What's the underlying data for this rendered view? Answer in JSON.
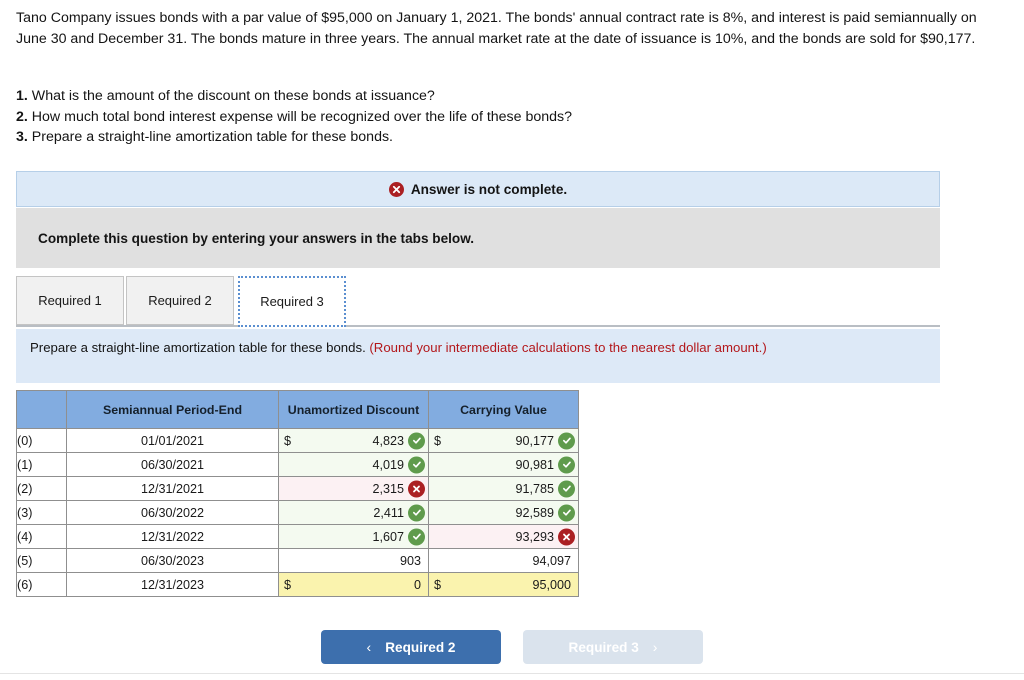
{
  "prompt": {
    "paragraph": "Tano Company issues bonds with a par value of $95,000 on January 1, 2021. The bonds' annual contract rate is 8%, and interest is paid semiannually on June 30 and December 31. The bonds mature in three years. The annual market rate at the date of issuance is 10%, and the bonds are sold for $90,177.",
    "questions": [
      {
        "num": "1.",
        "text": "What is the amount of the discount on these bonds at issuance?"
      },
      {
        "num": "2.",
        "text": "How much total bond interest expense will be recognized over the life of these bonds?"
      },
      {
        "num": "3.",
        "text": "Prepare a straight-line amortization table for these bonds."
      }
    ]
  },
  "status_banner": {
    "icon": "x-circle-icon",
    "text": "Answer is not complete.",
    "bg_color": "#dce9f7",
    "icon_color": "#ab2023"
  },
  "gray_banner": {
    "text": "Complete this question by entering your answers in the tabs below."
  },
  "tabs": {
    "items": [
      {
        "label": "Required 1",
        "active": false
      },
      {
        "label": "Required 2",
        "active": false
      },
      {
        "label": "Required 3",
        "active": true
      }
    ]
  },
  "requirement": {
    "text": "Prepare a straight-line amortization table for these bonds. ",
    "note": "(Round your intermediate calculations to the nearest dollar amount.)"
  },
  "table": {
    "headers": [
      "",
      "Semiannual Period-End",
      "Unamortized Discount",
      "Carrying Value"
    ],
    "rows": [
      {
        "idx": "(0)",
        "date": "01/01/2021",
        "discount": "4,823",
        "discount_dollar": "$",
        "discount_state": "ok",
        "carrying": "90,177",
        "carrying_dollar": "$",
        "carrying_state": "ok"
      },
      {
        "idx": "(1)",
        "date": "06/30/2021",
        "discount": "4,019",
        "discount_dollar": "",
        "discount_state": "ok",
        "carrying": "90,981",
        "carrying_dollar": "",
        "carrying_state": "ok"
      },
      {
        "idx": "(2)",
        "date": "12/31/2021",
        "discount": "2,315",
        "discount_dollar": "",
        "discount_state": "bad",
        "carrying": "91,785",
        "carrying_dollar": "",
        "carrying_state": "ok"
      },
      {
        "idx": "(3)",
        "date": "06/30/2022",
        "discount": "2,411",
        "discount_dollar": "",
        "discount_state": "ok",
        "carrying": "92,589",
        "carrying_dollar": "",
        "carrying_state": "ok"
      },
      {
        "idx": "(4)",
        "date": "12/31/2022",
        "discount": "1,607",
        "discount_dollar": "",
        "discount_state": "ok",
        "carrying": "93,293",
        "carrying_dollar": "",
        "carrying_state": "bad"
      },
      {
        "idx": "(5)",
        "date": "06/30/2023",
        "discount": "903",
        "discount_dollar": "",
        "discount_state": "none",
        "carrying": "94,097",
        "carrying_dollar": "",
        "carrying_state": "none"
      },
      {
        "idx": "(6)",
        "date": "12/31/2023",
        "discount": "0",
        "discount_dollar": "$",
        "discount_state": "total",
        "carrying": "95,000",
        "carrying_dollar": "$",
        "carrying_state": "total"
      }
    ],
    "header_bg": "#82ace0",
    "correct_bg": "#f4faf0",
    "incorrect_bg": "#fcf1f3",
    "total_bg": "#faf3ae"
  },
  "nav": {
    "prev_label": "Required 2",
    "prev_chevron": "‹",
    "next_label": "Required 3",
    "next_chevron": "›",
    "prev_color": "#3d6fad",
    "next_color": "#dae3ed"
  }
}
